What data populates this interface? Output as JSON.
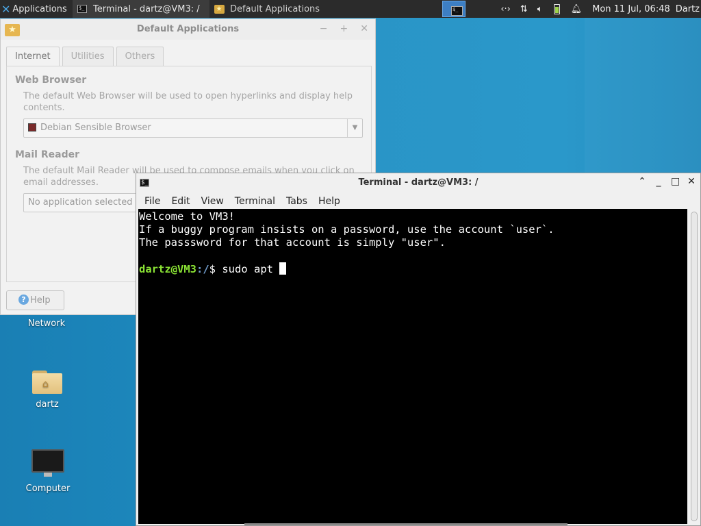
{
  "panel": {
    "applications_label": "Applications",
    "tasks": [
      {
        "title": "Terminal - dartz@VM3: /",
        "icon": "terminal-icon",
        "active": true
      },
      {
        "title": "Default Applications",
        "icon": "default-applications-icon",
        "active": false
      }
    ],
    "tray_icons": [
      "network-arrows-icon",
      "network-updown-icon",
      "volume-icon",
      "battery-icon",
      "notification-bell-icon"
    ],
    "clock": "Mon 11 Jul, 06:48",
    "user": "Dartz"
  },
  "desktop": {
    "icons": [
      {
        "label": "Network"
      },
      {
        "label": "dartz"
      },
      {
        "label": "Computer"
      }
    ]
  },
  "default_apps": {
    "title": "Default Applications",
    "tabs": [
      "Internet",
      "Utilities",
      "Others"
    ],
    "web_browser": {
      "heading": "Web Browser",
      "description": "The default Web Browser will be used to open hyperlinks and display help contents.",
      "selected": "Debian Sensible Browser"
    },
    "mail_reader": {
      "heading": "Mail Reader",
      "description": "The default Mail Reader will be used to compose emails when you click on email addresses.",
      "selected": "No application selected"
    },
    "help_label": "Help"
  },
  "terminal": {
    "title": "Terminal - dartz@VM3: /",
    "menus": [
      "File",
      "Edit",
      "View",
      "Terminal",
      "Tabs",
      "Help"
    ],
    "lines": [
      "Welcome to VM3!",
      "If a buggy program insists on a password, use the account `user`.",
      "The passsword for that account is simply \"user\".",
      ""
    ],
    "prompt_user": "dartz@VM3",
    "prompt_path": ":/",
    "prompt_symbol": "$ ",
    "command": "sudo apt "
  }
}
